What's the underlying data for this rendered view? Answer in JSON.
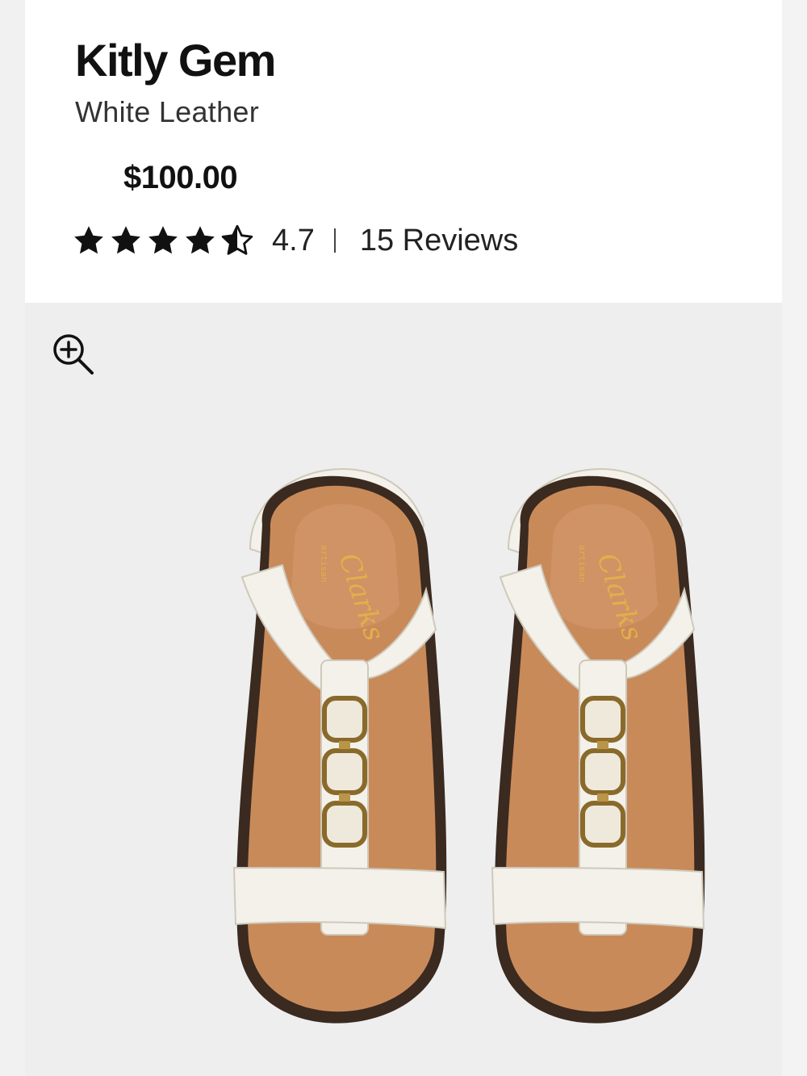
{
  "product": {
    "title": "Kitly Gem",
    "subtitle": "White Leather",
    "price": "$100.00"
  },
  "rating": {
    "stars": 4.5,
    "value": "4.7",
    "divider": "I",
    "reviews_label": "15 Reviews"
  },
  "gallery": {
    "zoom_icon": "zoom-in-icon",
    "brand_logo": "Clarks",
    "brand_sub": "artisan"
  },
  "colors": {
    "card_background": "#ffffff",
    "gallery_background": "#efeeee",
    "text_primary": "#111111",
    "footbed": "#c98a5a",
    "strap": "#f3f1ea",
    "hardware": "#b89548"
  }
}
